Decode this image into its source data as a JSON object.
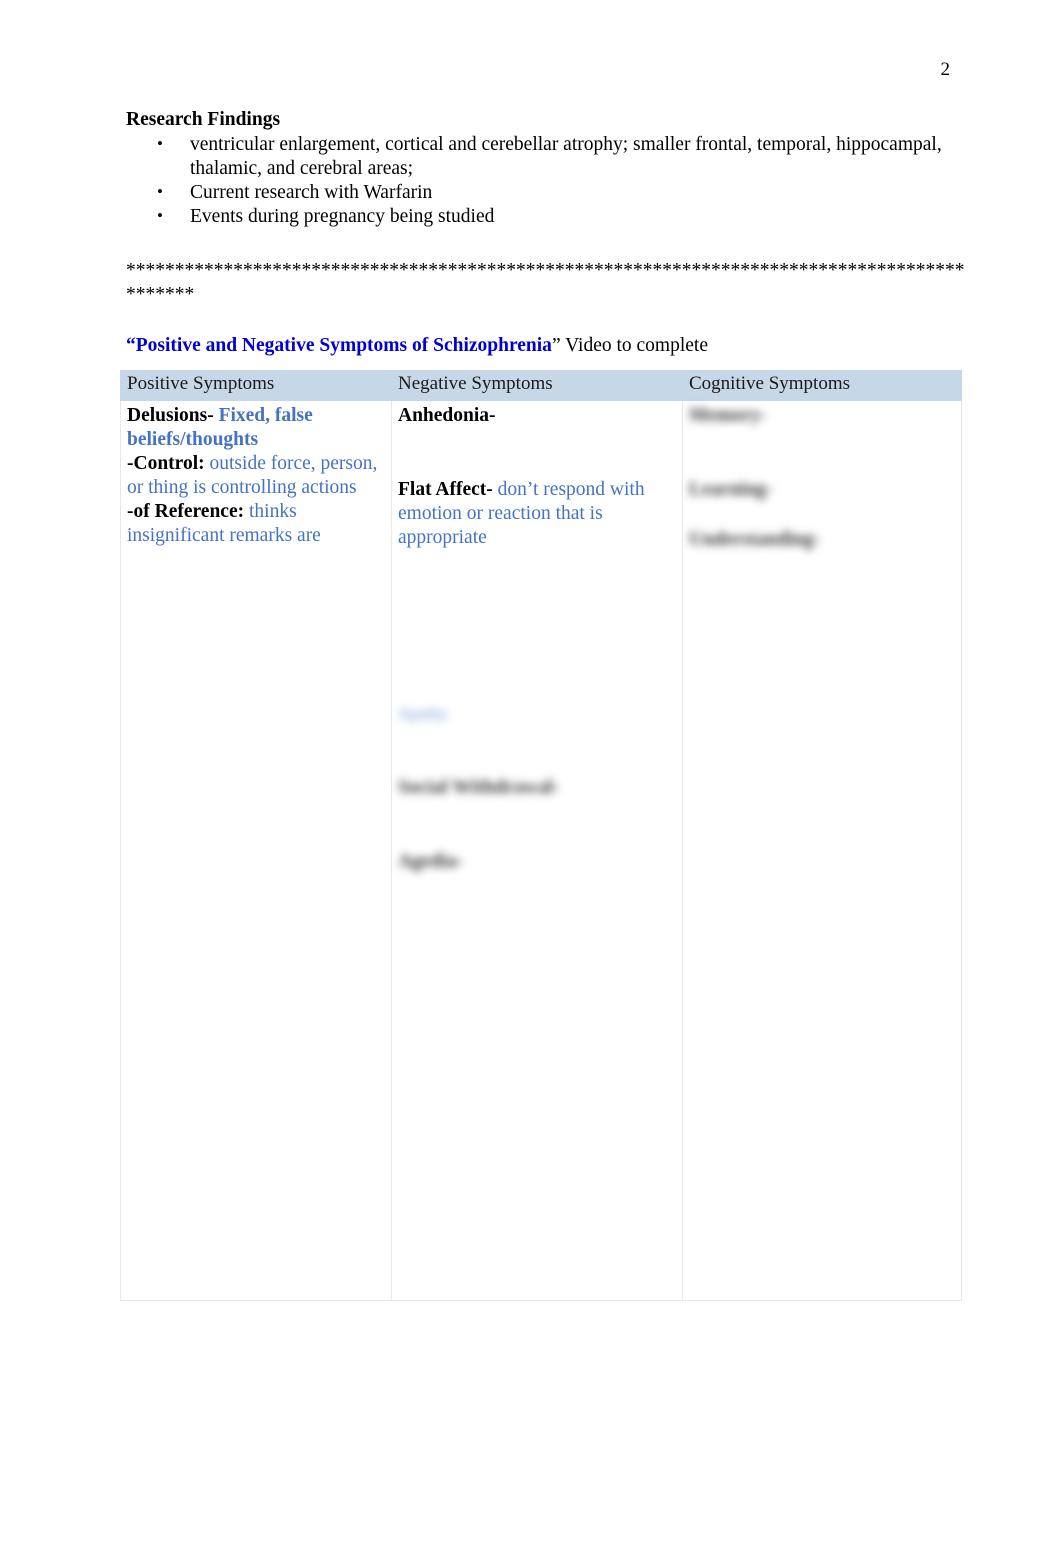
{
  "page": {
    "number": "2"
  },
  "research": {
    "heading": "Research Findings",
    "bullet_glyph": "•",
    "bullets": [
      "ventricular enlargement, cortical and cerebellar atrophy; smaller frontal, temporal, hippocampal, thalamic, and cerebral areas;",
      "Current research with Warfarin",
      "Events during pregnancy being studied"
    ]
  },
  "separator": {
    "asterisks": "*********************************************************************************************"
  },
  "video": {
    "open_quote": "“",
    "title": "Positive and Negative Symptoms of Schizophrenia",
    "close_quote": "”",
    "suffix": " Video to complete"
  },
  "table": {
    "headers": [
      "Positive Symptoms",
      "Negative Symptoms",
      "Cognitive Symptoms"
    ],
    "columns": {
      "positive": [
        {
          "term": "Delusions-",
          "answer": " Fixed, false beliefs/thoughts",
          "answer_bold": true
        },
        {
          "term": "-Control:",
          "answer": " outside force, person, or thing is controlling actions",
          "answer_bold": false
        },
        {
          "term": "-of Reference:",
          "answer": " thinks insignificant remarks are",
          "answer_bold": false
        }
      ],
      "negative": [
        {
          "term": "Anhedonia-",
          "answer": "",
          "answer_bold": false
        },
        {
          "term": "Flat Affect-",
          "answer": " don’t respond with emotion or reaction that is appropriate",
          "answer_bold": false
        }
      ],
      "negative_redacted": [
        {
          "text": "Apathy",
          "style": "blue"
        },
        {
          "text": "Social Withdrawal-",
          "style": "bold"
        },
        {
          "text": "Agedia-",
          "style": "bold"
        }
      ],
      "cognitive_redacted": [
        {
          "text": "Memory-",
          "style": "bold"
        },
        {
          "text": "Learning-",
          "style": "bold"
        },
        {
          "text": "Understanding-",
          "style": "bold"
        }
      ]
    }
  }
}
